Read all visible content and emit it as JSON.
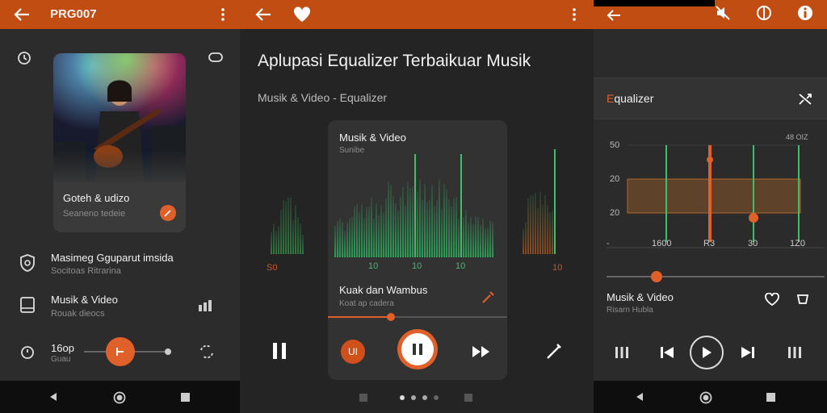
{
  "colors": {
    "accent": "#e0602a",
    "appbar": "#c14d12",
    "green": "#3fbf6a"
  },
  "screen1": {
    "title": "PRG007",
    "album_title": "Goteh & udizo",
    "album_subtitle": "Seaneno tedeie",
    "items": [
      {
        "title": "Masimeg Gguparut imsida",
        "subtitle": "Socitoas Ritrarina",
        "icon": "shield-icon"
      },
      {
        "title": "Musik & Video",
        "subtitle": "Rouak dieocs",
        "icon": "book-icon"
      }
    ],
    "player_label": "16op",
    "player_sub": "Guau",
    "progress": 0.5
  },
  "screen2": {
    "heading": "Aplupasi Equalizer Terbaikuar Musik",
    "subheading": "Musik & Video - Equalizer",
    "card_title": "Musik & Video",
    "card_subtitle": "Sunibe",
    "band_labels_left": [
      "S0"
    ],
    "band_labels": [
      "10",
      "10",
      "10"
    ],
    "band_labels_right": [
      "10"
    ],
    "track_title": "Kuak dan Wambus",
    "track_subtitle": "Koat ap cadera",
    "progress": 0.35,
    "small_btn_label": "UI",
    "page_dots": 4,
    "active_dot": 0
  },
  "screen3": {
    "title_accent": "E",
    "title_rest": "qualizer",
    "db_top_right": "48 OIZ",
    "y_labels": [
      "50",
      "20",
      "20",
      "-"
    ],
    "x_labels": [
      "1600",
      "R3",
      "30",
      "1Z0"
    ],
    "band_levels": [
      0.0,
      0.15,
      0.0,
      0.85,
      0.0
    ],
    "preamp": 0.23,
    "track_title": "Musik & Video",
    "track_subtitle": "Risarn Hubla"
  }
}
